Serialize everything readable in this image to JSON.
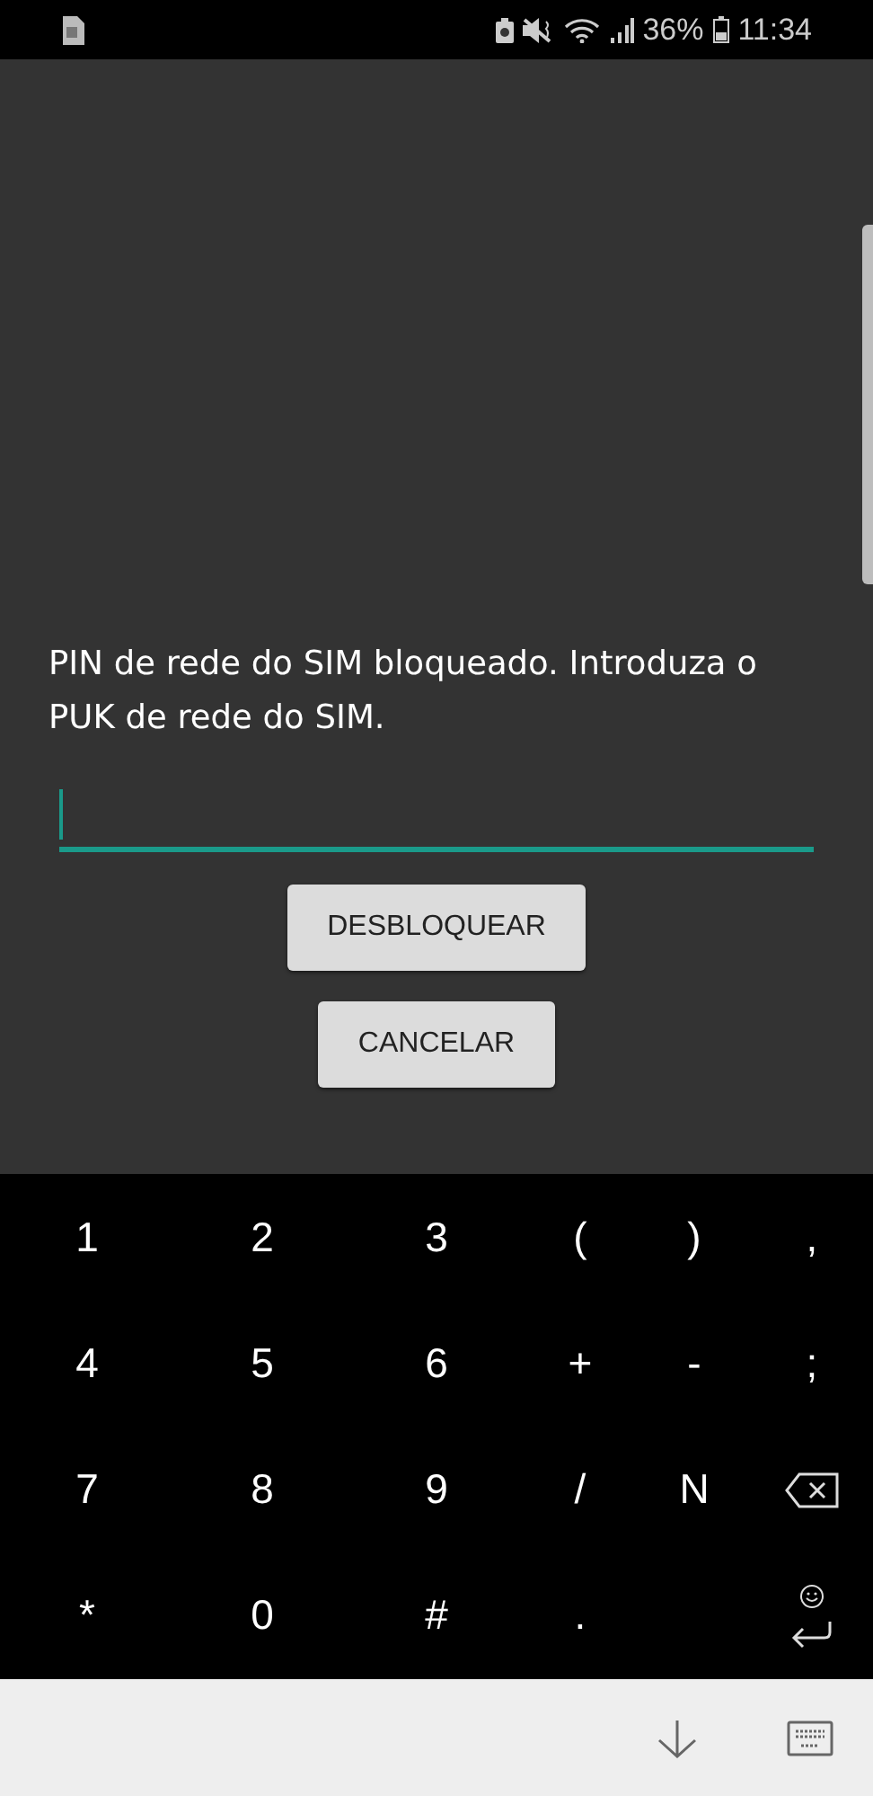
{
  "status_bar": {
    "battery": "36%",
    "time": "11:34"
  },
  "dialog": {
    "message": "PIN de rede do SIM bloqueado. Introduza o PUK de rede do SIM.",
    "field": {
      "focused": true
    },
    "buttons": [
      "DESBLOQUEAR",
      "CANCELAR"
    ]
  },
  "keyboard": {
    "rows": [
      [
        {
          "kind": "char",
          "label": "1"
        },
        {
          "kind": "char",
          "label": "2"
        },
        {
          "kind": "char",
          "label": "3"
        },
        {
          "kind": "char",
          "label": "("
        },
        {
          "kind": "char",
          "label": ")"
        },
        {
          "kind": "char",
          "label": ","
        }
      ],
      [
        {
          "kind": "char",
          "label": "4"
        },
        {
          "kind": "char",
          "label": "5"
        },
        {
          "kind": "char",
          "label": "6"
        },
        {
          "kind": "char",
          "label": "+"
        },
        {
          "kind": "char",
          "label": "-"
        },
        {
          "kind": "char",
          "label": ";"
        }
      ],
      [
        {
          "kind": "char",
          "label": "7"
        },
        {
          "kind": "char",
          "label": "8"
        },
        {
          "kind": "char",
          "label": "9"
        },
        {
          "kind": "char",
          "label": "/"
        },
        {
          "kind": "char",
          "label": "N"
        },
        {
          "kind": "backspace"
        }
      ],
      [
        {
          "kind": "char",
          "label": "*"
        },
        {
          "kind": "char",
          "label": "0"
        },
        {
          "kind": "char",
          "label": "#"
        },
        {
          "kind": "char",
          "label": "."
        },
        {
          "kind": "blank"
        },
        {
          "kind": "enter"
        }
      ]
    ]
  }
}
